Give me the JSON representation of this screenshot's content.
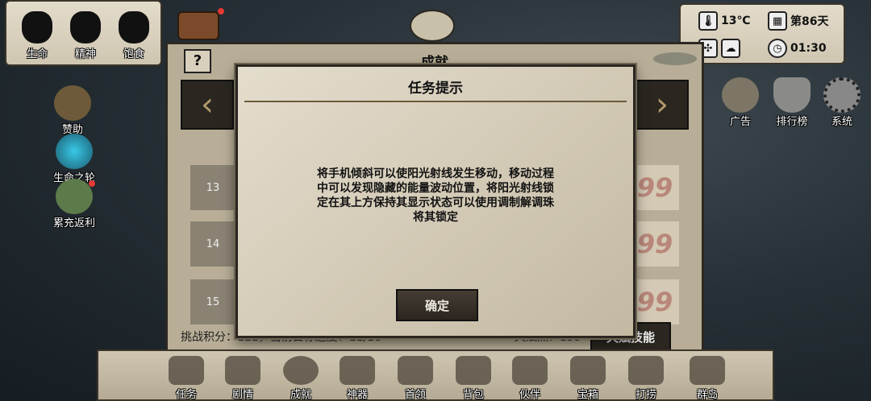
{
  "status": {
    "life_label": "生命",
    "spirit_label": "精神",
    "hunger_label": "饱食"
  },
  "environment": {
    "temperature": "13℃",
    "day": "第86天",
    "clock": "01:30"
  },
  "left_menu": {
    "sponsor_label": "赞助",
    "wheel_label": "生命之轮",
    "rebate_label": "累充返利"
  },
  "right_menu": {
    "ad_label": "广告",
    "ranking_label": "排行榜",
    "system_label": "系统"
  },
  "panel": {
    "title": "成就",
    "help_label": "?",
    "rows": [
      {
        "num": "13",
        "badge": "99"
      },
      {
        "num": "14",
        "badge": "99"
      },
      {
        "num": "15",
        "badge": "99"
      }
    ],
    "footer_text": "挑战积分：111，当前目标进度：11/18",
    "talent_points": "天赋点：135",
    "talent_button": "天赋技能"
  },
  "dialog": {
    "title": "任务提示",
    "message_lines": [
      "将手机倾斜可以使阳光射线发生移动，移动过程",
      "中可以发现隐藏的能量波动位置，将阳光射线锁",
      "定在其上方保持其显示状态可以使用调制解调珠",
      "将其锁定"
    ],
    "ok_label": "确定"
  },
  "bottom_tabs": [
    "任务",
    "剧情",
    "成就",
    "神器",
    "首领",
    "背包",
    "伙伴",
    "宝箱",
    "打捞",
    "群岛"
  ],
  "colors": {
    "parchment": "#d9d2c1",
    "dark_button": "#2b2720",
    "notification_dot": "#e53935"
  }
}
